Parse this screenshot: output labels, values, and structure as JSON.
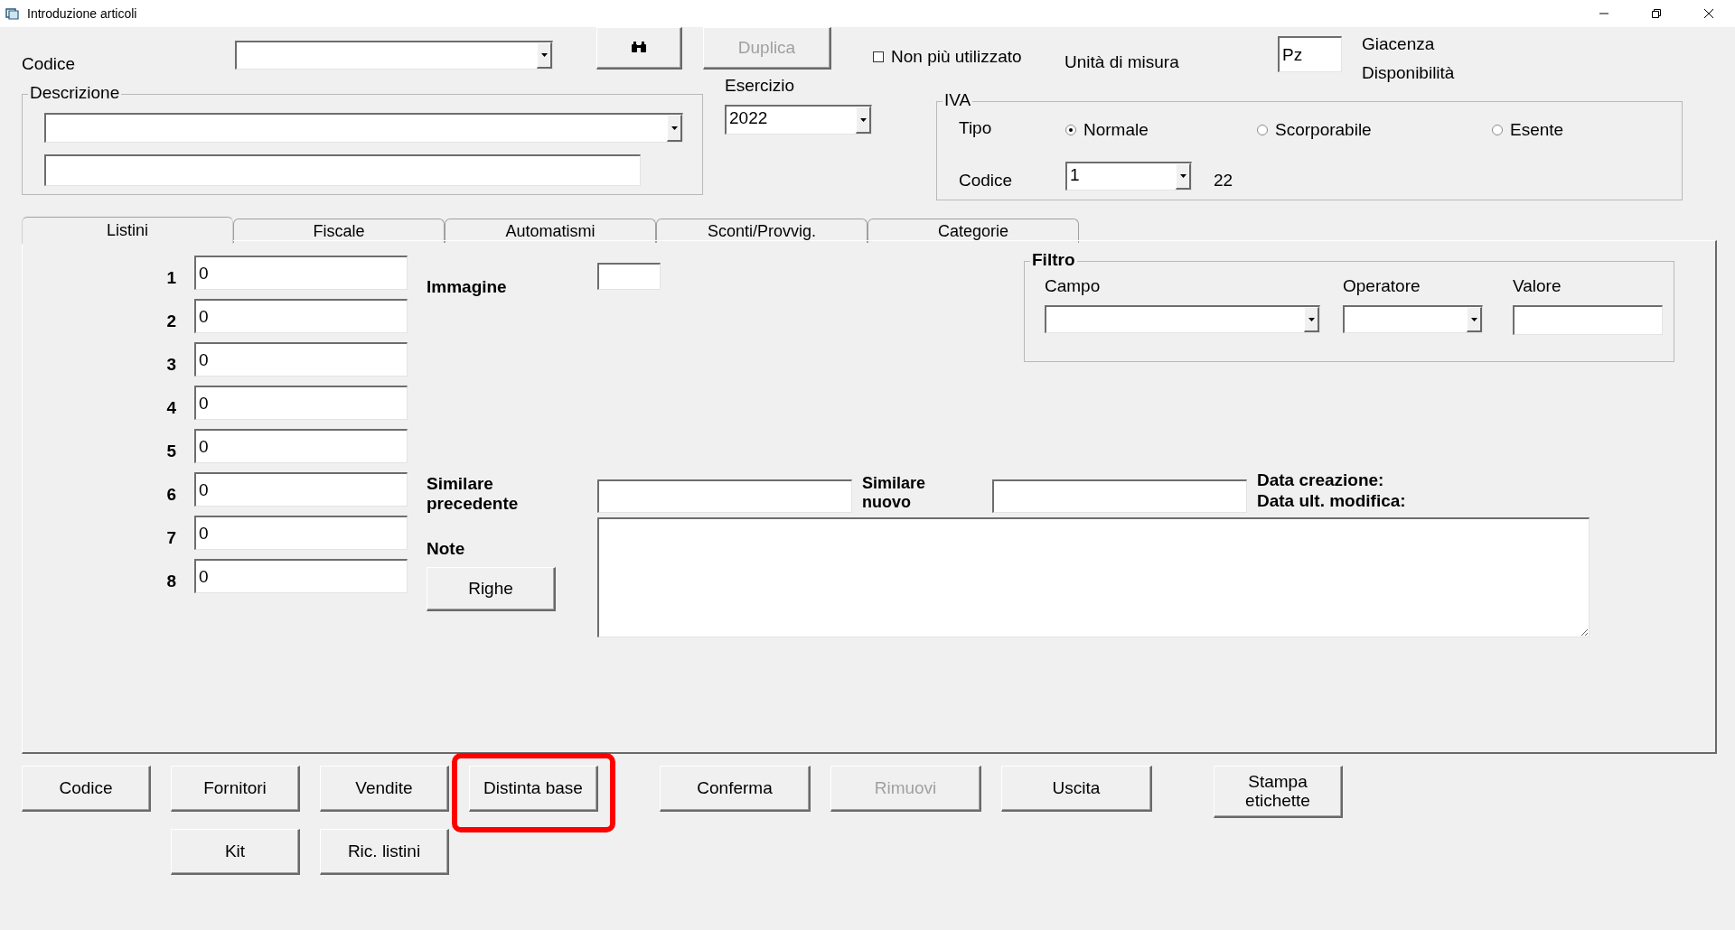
{
  "window": {
    "title": "Introduzione articoli"
  },
  "codice": {
    "label": "Codice"
  },
  "duplica_button": {
    "label": "Duplica",
    "disabled": true
  },
  "non_piu_utilizzato": {
    "label": "Non più utilizzato",
    "checked": false
  },
  "unita": {
    "label": "Unità di misura",
    "value": "Pz"
  },
  "giacenza_label": "Giacenza",
  "disponibilita_label": "Disponibilità",
  "descrizione": {
    "title": "Descrizione"
  },
  "esercizio": {
    "label": "Esercizio",
    "value": "2022"
  },
  "iva": {
    "title": "IVA",
    "tipo_label": "Tipo",
    "options": [
      {
        "label": "Normale",
        "selected": true
      },
      {
        "label": "Scorporabile",
        "selected": false
      },
      {
        "label": "Esente",
        "selected": false
      }
    ],
    "codice_label": "Codice",
    "codice_value": "1",
    "rate": "22"
  },
  "tabs": [
    {
      "label": "Listini",
      "selected": true
    },
    {
      "label": "Fiscale",
      "selected": false
    },
    {
      "label": "Automatismi",
      "selected": false
    },
    {
      "label": "Sconti/Provvig.",
      "selected": false
    },
    {
      "label": "Categorie",
      "selected": false
    }
  ],
  "listini": [
    {
      "number": "1",
      "value": "0"
    },
    {
      "number": "2",
      "value": "0"
    },
    {
      "number": "3",
      "value": "0"
    },
    {
      "number": "4",
      "value": "0"
    },
    {
      "number": "5",
      "value": "0"
    },
    {
      "number": "6",
      "value": "0"
    },
    {
      "number": "7",
      "value": "0"
    },
    {
      "number": "8",
      "value": "0"
    }
  ],
  "immagine_label": "Immagine",
  "filtro": {
    "title": "Filtro",
    "campo_label": "Campo",
    "operatore_label": "Operatore",
    "valore_label": "Valore"
  },
  "similare_precedente_label": "Similare precedente",
  "similare_nuovo_label": "Similare nuovo",
  "data_creazione_label": "Data creazione:",
  "data_modifica_label": "Data ult. modifica:",
  "note_label": "Note",
  "righe_button": "Righe",
  "action_groups": [
    {
      "buttons": [
        {
          "label": "Codice",
          "disabled": false,
          "highlighted": false
        },
        {
          "label": "Fornitori",
          "disabled": false,
          "highlighted": false
        },
        {
          "label": "Vendite",
          "disabled": false,
          "highlighted": false
        },
        {
          "label": "Distinta base",
          "disabled": false,
          "highlighted": true
        }
      ]
    },
    {
      "buttons": [
        {
          "label": "Conferma",
          "disabled": false,
          "highlighted": false
        },
        {
          "label": "Rimuovi",
          "disabled": true,
          "highlighted": false
        },
        {
          "label": "Uscita",
          "disabled": false,
          "highlighted": false
        }
      ]
    },
    {
      "buttons": [
        {
          "label": "Stampa etichette",
          "disabled": false,
          "highlighted": false
        }
      ]
    }
  ],
  "secondary_buttons": [
    {
      "label": "Kit",
      "disabled": false,
      "highlighted": false
    },
    {
      "label": "Ric. listini",
      "disabled": false,
      "highlighted": false
    }
  ]
}
